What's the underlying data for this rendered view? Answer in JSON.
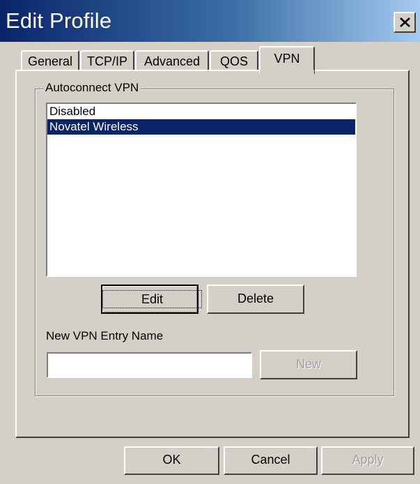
{
  "window": {
    "title": "Edit Profile"
  },
  "tabs": [
    {
      "label": "General"
    },
    {
      "label": "TCP/IP"
    },
    {
      "label": "Advanced"
    },
    {
      "label": "QOS"
    },
    {
      "label": "VPN",
      "active": true
    }
  ],
  "autoconnect": {
    "group_label": "Autoconnect VPN",
    "items": [
      {
        "label": "Disabled",
        "selected": false
      },
      {
        "label": "Novatel Wireless",
        "selected": true
      }
    ],
    "edit_label": "Edit",
    "delete_label": "Delete",
    "new_entry_label": "New VPN Entry Name",
    "new_entry_value": "",
    "new_label": "New"
  },
  "footer": {
    "ok_label": "OK",
    "cancel_label": "Cancel",
    "apply_label": "Apply"
  },
  "colors": {
    "selection": "#0a246a",
    "face": "#d4d0c8",
    "title_start": "#0a246a",
    "title_end": "#a6caf0"
  },
  "icons": {
    "close": "close-icon"
  }
}
